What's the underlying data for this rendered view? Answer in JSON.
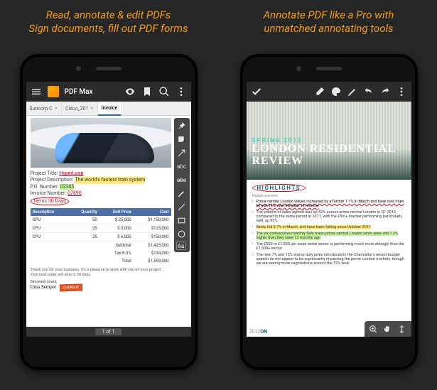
{
  "left": {
    "caption": "Read, annotate & edit PDFs\nSign documents, fill out PDF forms",
    "appbar": {
      "title": "PDF Max"
    },
    "tabs": [
      {
        "label": "Suncorp C"
      },
      {
        "label": "Cisco_201"
      },
      {
        "label": "Invoice"
      }
    ],
    "project": {
      "title_label": "Project Title:",
      "title_value": "HyperLoop",
      "desc_label": "Project Description:",
      "desc_value": "The world's fastest train system",
      "po_label": "P.O. Number:",
      "po_value": "02345",
      "invno_label": "Invoice Number:",
      "invno_value": "07890",
      "terms": "Terms 30 Days"
    },
    "table": {
      "headers": [
        "Description",
        "Quantity",
        "Unit Price",
        "Cost"
      ],
      "rows": [
        [
          "GPU",
          "50",
          "$ 25,000",
          "$1,150,000"
        ],
        [
          "CPU",
          "25",
          "$ 5,000",
          "$125,000"
        ],
        [
          "CPU",
          "25",
          "$ 6,000",
          "$150,000"
        ]
      ],
      "totals": [
        [
          "Subtotal",
          "$1,425,000"
        ],
        [
          "Tax 8.5%",
          "$134,000"
        ],
        [
          "Total",
          "$1,559,000"
        ]
      ]
    },
    "note": "Thank you for your business. It's a pleasure to work with you on your project.\nYour next order will ship in 30 days.",
    "signature_label": "Sincerely yours,",
    "signature_name": "Uma Semper",
    "stamp": "OVERDUE",
    "pager": "1 of 1",
    "tool_labels": {
      "abc1": "abc",
      "abc2": "abc",
      "aa": "Aa"
    }
  },
  "right": {
    "caption": "Annotate PDF like a Pro with unmatched annotating tools",
    "hero": {
      "season": "SPRING 2012",
      "title": "LONDON RESIDENTIAL REVIEW"
    },
    "highlights_label": "HIGHLIGHTS",
    "subtitle": "Market overview",
    "bullets": [
      {
        "text": "Prime central London values increased by a further 1.1% in March and have now risen by just 11% over the past 12 months",
        "mark": "ins-red"
      },
      {
        "text": "The volume of sales agreed was up 42% across prime central London in Q1 2012 compared to the same period in 2011, with the £5m+ bracket performing particularly well, up 93%",
        "mark": ""
      },
      {
        "text": "Rents fell 0.7% in March, and have been falling since October 2011",
        "mark": "mk-y"
      },
      {
        "text": "The six consecutive monthly falls mean prime central London rents were still 1.2% higher than they were 12 months ago",
        "mark": "mk-g"
      },
      {
        "text": "The £500 to £1,500 per week rental sector is performing much more strongly than the £1,500+ sector",
        "mark": ""
      },
      {
        "text": "The new 7% and 15% stamp duty rates introduced in the Chancellor's recent budget speech do not appear to be significantly impacting the prime London markets, though we are seeing more negotiations around the 15% level",
        "mark": ""
      }
    ],
    "foot_stamp_year": "2012",
    "foot_stamp_word": "ON"
  }
}
